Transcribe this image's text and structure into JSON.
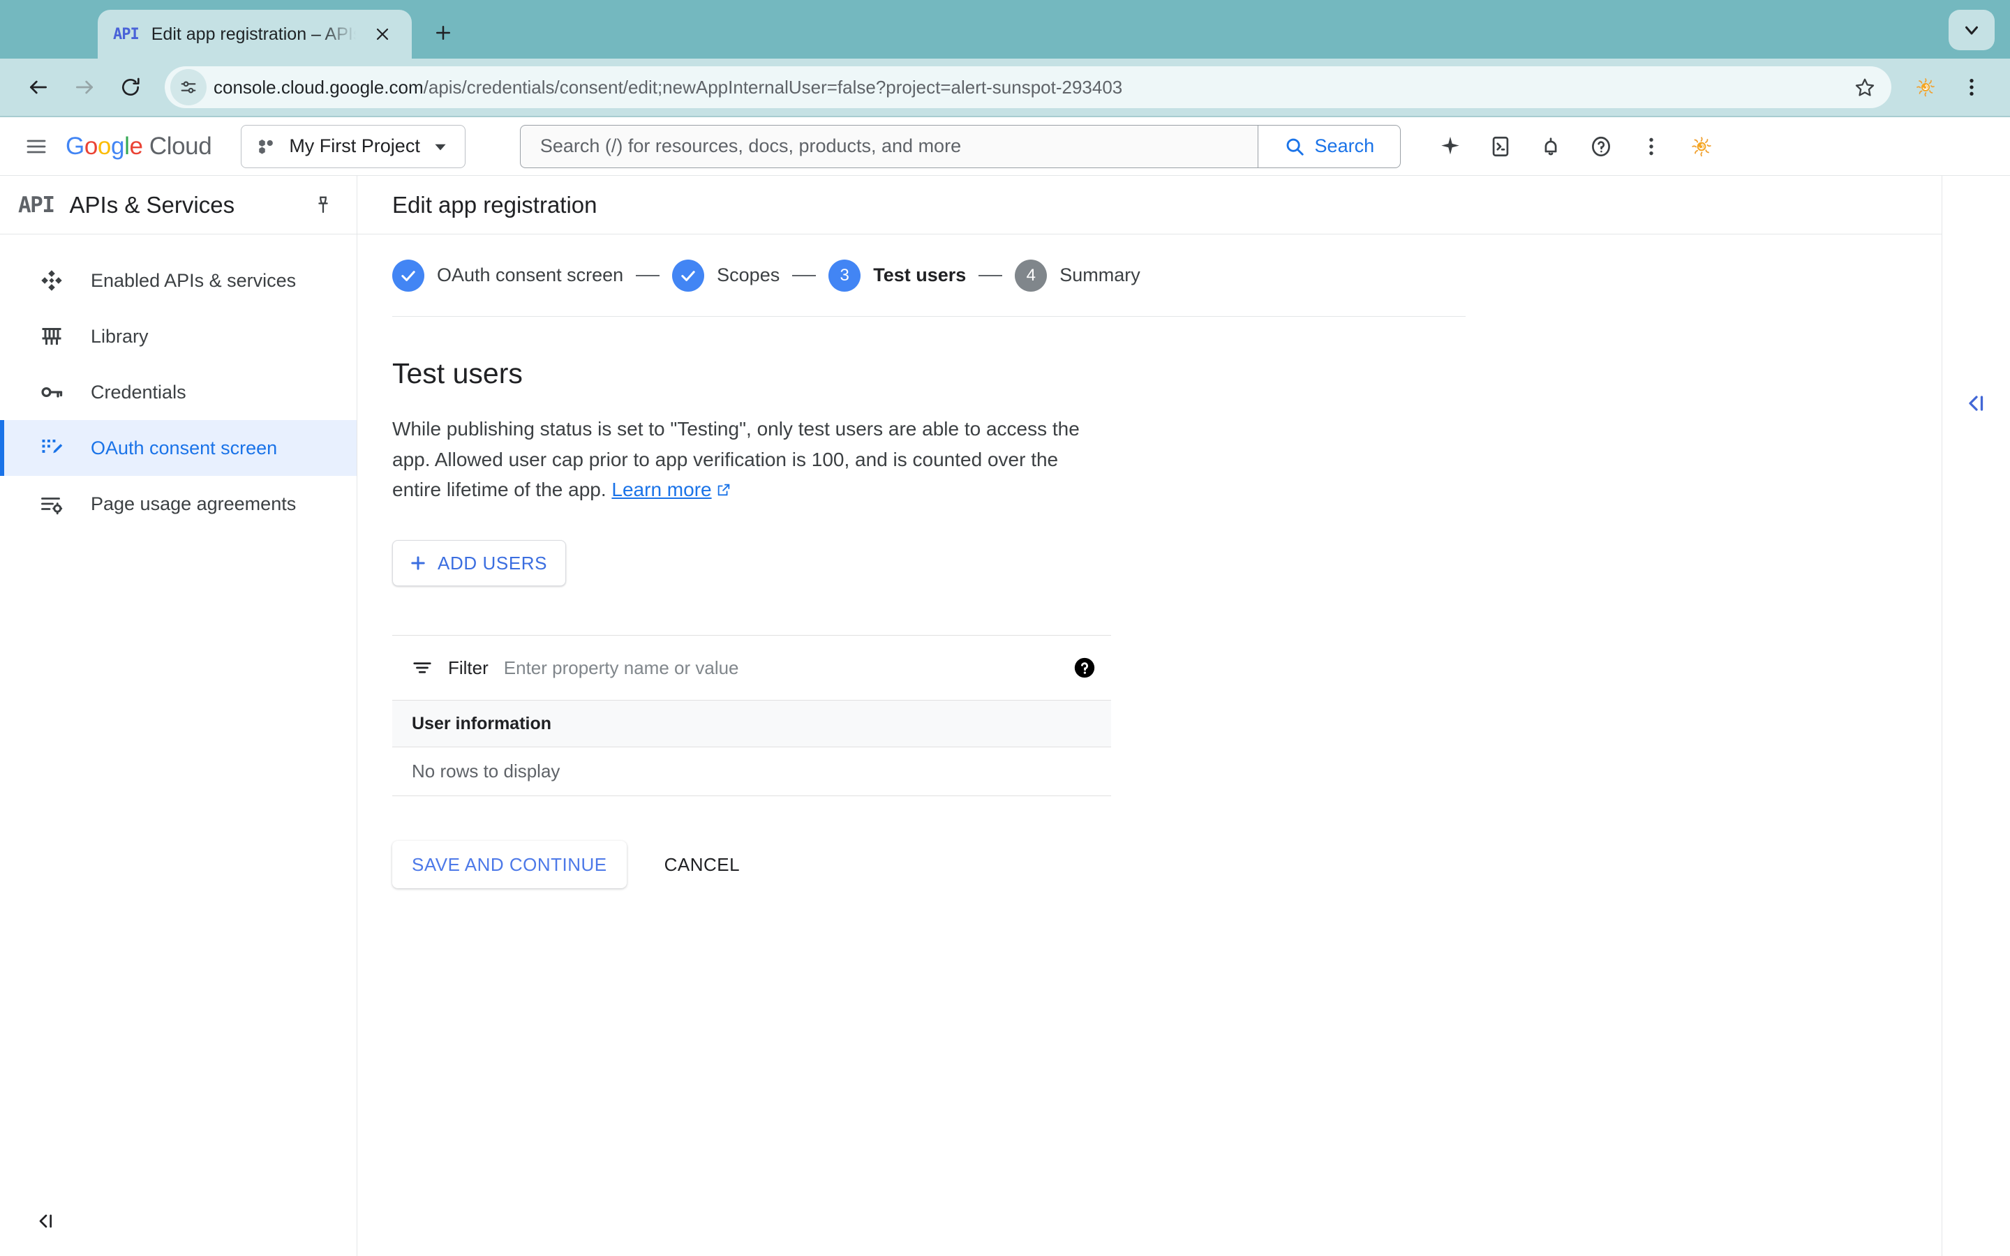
{
  "browser": {
    "tab": {
      "favicon_text": "API",
      "title": "Edit app registration – APIs &",
      "close_icon": "close-icon"
    },
    "new_tab_label": "+",
    "omnibox": {
      "url_host": "console.cloud.google.com",
      "url_path": "/apis/credentials/consent/edit;newAppInternalUser=false?project=alert-sunspot-293403",
      "site_info_icon": "site-settings-icon",
      "bookmark_icon": "star-icon"
    },
    "nav": {
      "back_icon": "back-arrow-icon",
      "forward_icon": "forward-arrow-icon",
      "reload_icon": "reload-icon",
      "menu_icon": "three-dot-menu-icon",
      "profile_icon": "sun-avatar-icon",
      "tab_search_icon": "chevron-down-icon"
    },
    "colors": {
      "tabstrip": "#74b8bf",
      "toolbar": "#c5e1e4",
      "omnibox": "#eef7f8"
    }
  },
  "gcloud_header": {
    "menu_icon": "hamburger-menu-icon",
    "logo": {
      "google": "Google",
      "cloud": "Cloud"
    },
    "project": {
      "name": "My First Project",
      "icon": "project-dots-icon",
      "chevron": "chevron-down-icon"
    },
    "search": {
      "placeholder": "Search (/) for resources, docs, products, and more",
      "button_label": "Search",
      "button_icon": "search-icon"
    },
    "icons": [
      {
        "name": "gemini-sparkle-icon"
      },
      {
        "name": "cloud-shell-terminal-icon"
      },
      {
        "name": "notifications-bell-icon"
      },
      {
        "name": "help-question-icon"
      },
      {
        "name": "more-vert-icon"
      },
      {
        "name": "account-avatar-icon"
      }
    ]
  },
  "sidebar": {
    "product_icon": "API",
    "product_title": "APIs & Services",
    "pin_icon": "pin-icon",
    "items": [
      {
        "label": "Enabled APIs & services",
        "icon": "enabled-apis-icon",
        "active": false
      },
      {
        "label": "Library",
        "icon": "library-icon",
        "active": false
      },
      {
        "label": "Credentials",
        "icon": "key-icon",
        "active": false
      },
      {
        "label": "OAuth consent screen",
        "icon": "oauth-consent-icon",
        "active": true
      },
      {
        "label": "Page usage agreements",
        "icon": "page-usage-agreements-icon",
        "active": false
      }
    ],
    "collapse_icon": "collapse-left-icon"
  },
  "page": {
    "title": "Edit app registration",
    "stepper": [
      {
        "label": "OAuth consent screen",
        "state": "done",
        "marker": "check"
      },
      {
        "label": "Scopes",
        "state": "done",
        "marker": "check"
      },
      {
        "label": "Test users",
        "state": "current",
        "marker": "3"
      },
      {
        "label": "Summary",
        "state": "todo",
        "marker": "4"
      }
    ],
    "section": {
      "heading": "Test users",
      "body_part1": "While publishing status is set to \"Testing\", only test users are able to access the app. Allowed user cap prior to app verification is 100, and is counted over the entire lifetime of the app. ",
      "learn_more": "Learn more",
      "external_link_icon": "open-in-new-icon"
    },
    "add_users_button": {
      "label": "ADD USERS",
      "icon": "plus-icon"
    },
    "table": {
      "filter_icon": "filter-list-icon",
      "filter_label": "Filter",
      "filter_placeholder": "Enter property name or value",
      "help_icon": "help-filled-icon",
      "columns": [
        "User information"
      ],
      "rows": [],
      "empty_text": "No rows to display"
    },
    "actions": {
      "save_label": "SAVE AND CONTINUE",
      "cancel_label": "CANCEL"
    },
    "right_rail_collapse_icon": "collapse-right-panel-icon"
  }
}
